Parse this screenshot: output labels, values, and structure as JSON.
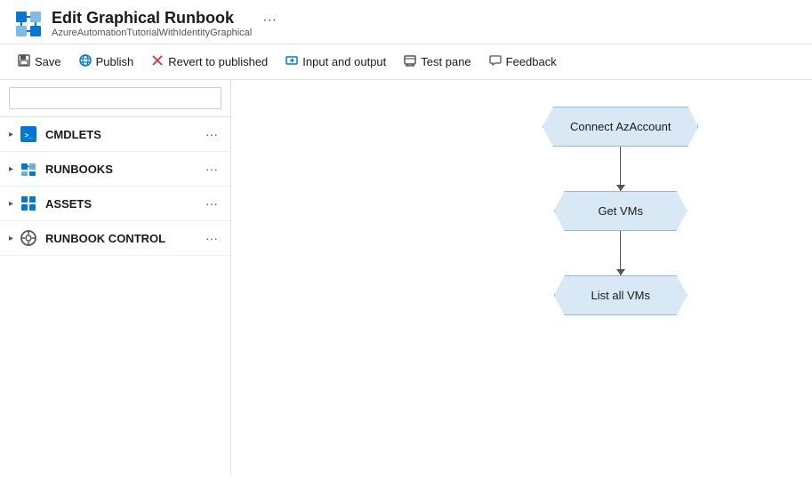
{
  "header": {
    "title": "Edit Graphical Runbook",
    "subtitle": "AzureAutomationTutorialWithIdentityGraphical",
    "ellipsis": "···"
  },
  "toolbar": {
    "save_label": "Save",
    "publish_label": "Publish",
    "revert_label": "Revert to published",
    "inputoutput_label": "Input and output",
    "testpane_label": "Test pane",
    "feedback_label": "Feedback"
  },
  "sidebar": {
    "search_placeholder": "",
    "items": [
      {
        "label": "CMDLETS",
        "icon": "cmdlets-icon"
      },
      {
        "label": "RUNBOOKS",
        "icon": "runbooks-icon"
      },
      {
        "label": "ASSETS",
        "icon": "assets-icon"
      },
      {
        "label": "RUNBOOK CONTROL",
        "icon": "runbookctrl-icon"
      }
    ]
  },
  "canvas": {
    "nodes": [
      {
        "label": "Connect AzAccount"
      },
      {
        "label": "Get VMs"
      },
      {
        "label": "List all VMs"
      }
    ]
  }
}
